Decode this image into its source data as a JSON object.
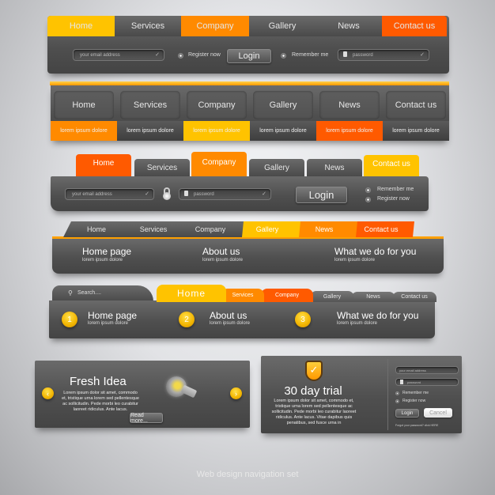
{
  "colors": {
    "yellow": "#ffc300",
    "orange": "#ff8a00",
    "red_orange": "#ff5a00",
    "panel_gray": "#555555"
  },
  "nav1": {
    "tabs": [
      {
        "label": "Home",
        "color": "yellow"
      },
      {
        "label": "Services",
        "color": "gray"
      },
      {
        "label": "Company",
        "color": "orange"
      },
      {
        "label": "Gallery",
        "color": "gray"
      },
      {
        "label": "News",
        "color": "gray"
      },
      {
        "label": "Contact us",
        "color": "red_orange"
      }
    ],
    "email_placeholder": "your email address",
    "register_label": "Register now",
    "login_label": "Login",
    "remember_label": "Remember me",
    "password_placeholder": "password"
  },
  "nav2": {
    "tabs": [
      {
        "label": "Home",
        "sub": "lorem ipsum dolore",
        "sub_color": "orange"
      },
      {
        "label": "Services",
        "sub": "lorem ipsum dolore",
        "sub_color": "gray"
      },
      {
        "label": "Company",
        "sub": "lorem ipsum dolore",
        "sub_color": "yellow"
      },
      {
        "label": "Gallery",
        "sub": "lorem ipsum dolore",
        "sub_color": "gray"
      },
      {
        "label": "News",
        "sub": "lorem ipsum dolore",
        "sub_color": "red_orange"
      },
      {
        "label": "Contact us",
        "sub": "lorem ipsum dolore",
        "sub_color": "gray"
      }
    ]
  },
  "nav3": {
    "tabs": [
      {
        "label": "Home",
        "color": "red_orange"
      },
      {
        "label": "Services",
        "color": "gray"
      },
      {
        "label": "Company",
        "color": "orange"
      },
      {
        "label": "Gallery",
        "color": "gray"
      },
      {
        "label": "News",
        "color": "gray"
      },
      {
        "label": "Contact us",
        "color": "yellow"
      }
    ],
    "email_placeholder": "your email address",
    "password_placeholder": "password",
    "login_label": "Login",
    "remember_label": "Remember me",
    "register_label": "Register now"
  },
  "nav4": {
    "tabs": [
      {
        "label": "Home",
        "color": "gray"
      },
      {
        "label": "Services",
        "color": "gray"
      },
      {
        "label": "Company",
        "color": "gray"
      },
      {
        "label": "Gallery",
        "color": "yellow"
      },
      {
        "label": "News",
        "color": "orange"
      },
      {
        "label": "Contact us",
        "color": "red_orange"
      }
    ],
    "items": [
      {
        "title": "Home page",
        "sub": "lorem ipsum dolore"
      },
      {
        "title": "About us",
        "sub": "lorem ipsum dolore"
      },
      {
        "title": "What we do for you",
        "sub": "lorem ipsum dolore"
      }
    ]
  },
  "nav5": {
    "search_placeholder": "Search....",
    "tabs": [
      {
        "label": "Home",
        "color": "yellow"
      },
      {
        "label": "Services",
        "color": "orange"
      },
      {
        "label": "Company",
        "color": "red_orange"
      },
      {
        "label": "Gallery",
        "color": "gray"
      },
      {
        "label": "News",
        "color": "gray"
      },
      {
        "label": "Contact us",
        "color": "gray"
      }
    ],
    "items": [
      {
        "num": "1",
        "title": "Home page",
        "sub": "lorem ipsum dolore"
      },
      {
        "num": "2",
        "title": "About us",
        "sub": "lorem ipsum dolore"
      },
      {
        "num": "3",
        "title": "What we do for you",
        "sub": "lorem ipsum dolore"
      }
    ]
  },
  "slider": {
    "title": "Fresh Idea",
    "body": "Lorem ipsum dolor sit amet, commodo et, tristique urna lorem sed pellentesque ac sollicitudin. Pede morbi leo curabitur laoreet ridiculus. Ante lacus.",
    "read_more": "Read more...",
    "prev_icon": "chevron-left",
    "next_icon": "chevron-right",
    "image_icon": "light-bulb"
  },
  "trial": {
    "title": "30 day trial",
    "body": "Lorem ipsum dolor sit amet, commodo et, tristique urna lorem sed pellentesque ac sollicitudin. Pede morbi leo curabitur laoreet ridiculus. Ante lacus. Vitae dapibus quis penatibus, sed fusce urna in",
    "email_placeholder": "your email address",
    "password_placeholder": "password",
    "remember_label": "Remember me",
    "register_label": "Register now",
    "login_label": "Login",
    "cancel_label": "Cancel",
    "forgot_text": "Forgot your password?",
    "forgot_link": "click HERE"
  },
  "caption": "Web design navigation set"
}
